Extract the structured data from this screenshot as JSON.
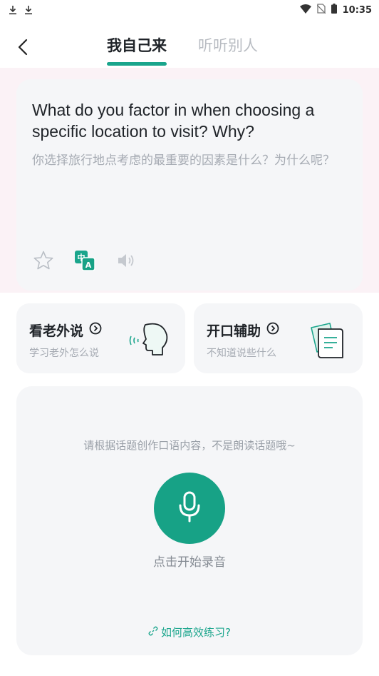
{
  "status_bar": {
    "time": "10:35",
    "left_icons": [
      "download-icon",
      "download-icon"
    ],
    "right_icons": [
      "wifi-icon",
      "no-sim-icon",
      "battery-icon"
    ]
  },
  "header": {
    "back_icon": "chevron-left-icon",
    "tabs": [
      {
        "label": "我自己来",
        "active": true
      },
      {
        "label": "听听别人",
        "active": false
      }
    ]
  },
  "question_card": {
    "question_en": "What do you factor in when choosing a specific location to visit? Why?",
    "question_zh": "你选择旅行地点考虑的最重要的因素是什么？为什么呢？",
    "actions": [
      "star-icon",
      "translate-icon",
      "speaker-icon"
    ]
  },
  "helpers": [
    {
      "title": "看老外说",
      "subtitle": "学习老外怎么说",
      "icon": "speaking-head-icon"
    },
    {
      "title": "开口辅助",
      "subtitle": "不知道说些什么",
      "icon": "document-icon"
    }
  ],
  "record_panel": {
    "hint": "请根据话题创作口语内容，不是朗读话题哦~",
    "record_label": "点击开始录音",
    "practice_link": "如何高效练习?"
  },
  "colors": {
    "accent": "#17a286",
    "card_bg": "#f5f6f8",
    "pink_band": "#fbf2f6",
    "muted_text": "#a6abb3"
  }
}
